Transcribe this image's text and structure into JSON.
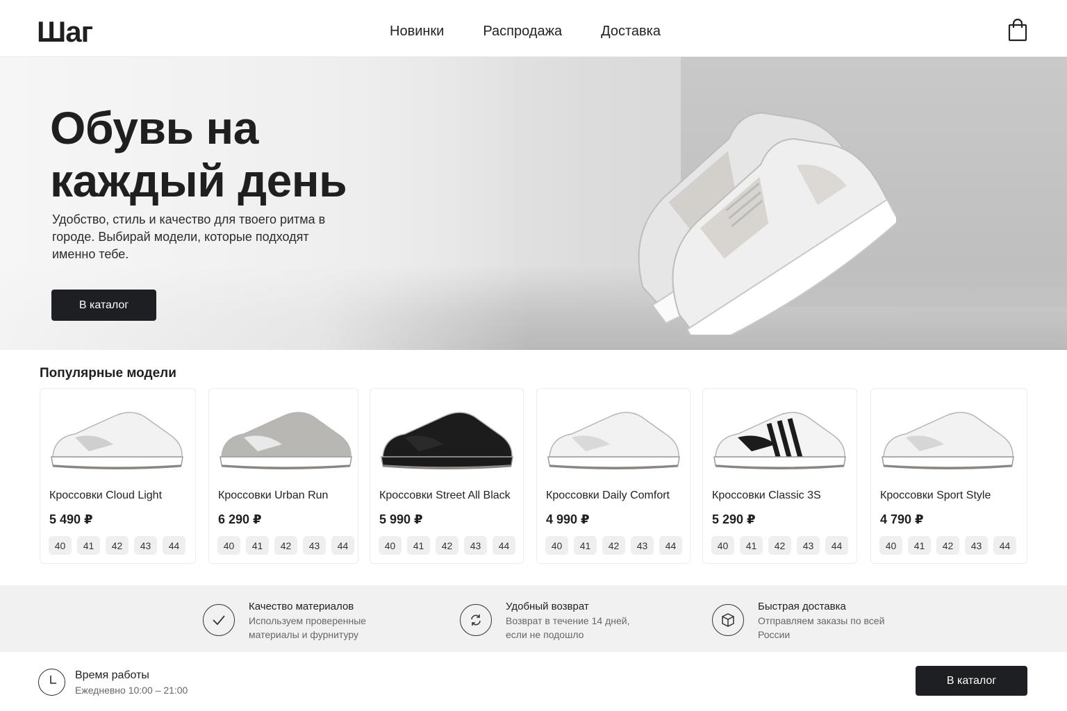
{
  "header": {
    "logo": "Шаг",
    "nav": [
      "Новинки",
      "Распродажа",
      "Доставка"
    ],
    "cart_icon": "shopping-bag-icon"
  },
  "hero": {
    "title_line1": "Обувь на",
    "title_line2": "каждый день",
    "subtitle": "Удобство, стиль и качество для твоего ритма в городе. Выбирай модели, которые подходят именно тебе.",
    "button": "В каталог"
  },
  "popular": {
    "title": "Популярные модели",
    "products": [
      {
        "name": "Кроссовки Cloud Light",
        "price": "5 490 ₽",
        "sizes": [
          "40",
          "41",
          "42",
          "43",
          "44"
        ],
        "color": "#f2f2f2",
        "accent": "#cfcfcf"
      },
      {
        "name": "Кроссовки Urban Run",
        "price": "6 290 ₽",
        "sizes": [
          "40",
          "41",
          "42",
          "43",
          "44"
        ],
        "color": "#b9b7b4",
        "accent": "#e9e9e9"
      },
      {
        "name": "Кроссовки Street All Black",
        "price": "5 990 ₽",
        "sizes": [
          "40",
          "41",
          "42",
          "43",
          "44"
        ],
        "color": "#1c1c1c",
        "accent": "#2a2a2a"
      },
      {
        "name": "Кроссовки Daily Comfort",
        "price": "4 990 ₽",
        "sizes": [
          "40",
          "41",
          "42",
          "43",
          "44"
        ],
        "color": "#f2f2f2",
        "accent": "#d9d9d9"
      },
      {
        "name": "Кроссовки Classic 3S",
        "price": "5 290 ₽",
        "sizes": [
          "40",
          "41",
          "42",
          "43",
          "44"
        ],
        "color": "#f4f4f4",
        "accent": "#1c1c1c"
      },
      {
        "name": "Кроссовки Sport Style",
        "price": "4 790 ₽",
        "sizes": [
          "40",
          "41",
          "42",
          "43",
          "44"
        ],
        "color": "#f2f2f2",
        "accent": "#d6d6d6"
      }
    ]
  },
  "features": [
    {
      "title": "Качество материалов",
      "text": "Используем проверенные материалы и фурнитуру",
      "icon": "check-icon"
    },
    {
      "title": "Удобный возврат",
      "text": "Возврат в течение 14 дней, если не подошло",
      "icon": "return-icon"
    },
    {
      "title": "Быстрая доставка",
      "text": "Отправляем заказы по всей России",
      "icon": "box-icon"
    }
  ],
  "bottom": {
    "hours_title": "Время работы",
    "hours_text": "Ежедневно 10:00 – 21:00",
    "button": "В каталог",
    "clock_icon": "clock-icon"
  }
}
